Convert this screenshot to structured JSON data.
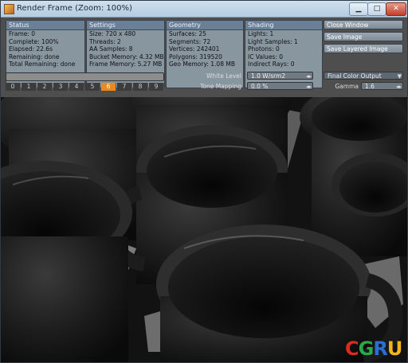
{
  "window": {
    "title": "Render Frame (Zoom: 100%)"
  },
  "status": {
    "header": "Status",
    "rows": [
      "Frame: 0",
      "Complete: 100%",
      "Elapsed: 22.6s",
      "Remaining: done",
      "Total Remaining: done"
    ]
  },
  "settings": {
    "header": "Settings",
    "rows": [
      "Size: 720 x 480",
      "Threads: 2",
      "AA Samples: 8",
      "Bucket Memory: 4.32 MB",
      "Frame Memory: 5.27 MB"
    ]
  },
  "geometry": {
    "header": "Geometry",
    "rows": [
      "Surfaces: 25",
      "Segments: 72",
      "Vertices: 242401",
      "Polygons: 319520",
      "Geo Memory: 1.08 MB"
    ]
  },
  "shading": {
    "header": "Shading",
    "rows": [
      "Lights: 1",
      "Light Samples: 1",
      "Photons: 0",
      "IC Values: 0",
      "Indirect Rays: 0"
    ]
  },
  "actions": {
    "close": "Close Window",
    "save": "Save Image",
    "save_layered": "Save Layered Image"
  },
  "buckets": {
    "items": [
      "0",
      "1",
      "2",
      "3",
      "4",
      "5",
      "6",
      "7",
      "8",
      "9"
    ],
    "active": "6"
  },
  "controls": {
    "white_level_label": "White Level",
    "white_level_value": "1.0 W/srm2",
    "tone_mapping_label": "Tone Mapping",
    "tone_mapping_value": "0.0 %",
    "output_value": "Final Color Output",
    "gamma_label": "Gamma",
    "gamma_value": "1.6"
  },
  "logo": {
    "text": "CGRU",
    "colors": [
      "#d62d20",
      "#2aa84a",
      "#2b6fd1",
      "#f2b51b"
    ]
  }
}
